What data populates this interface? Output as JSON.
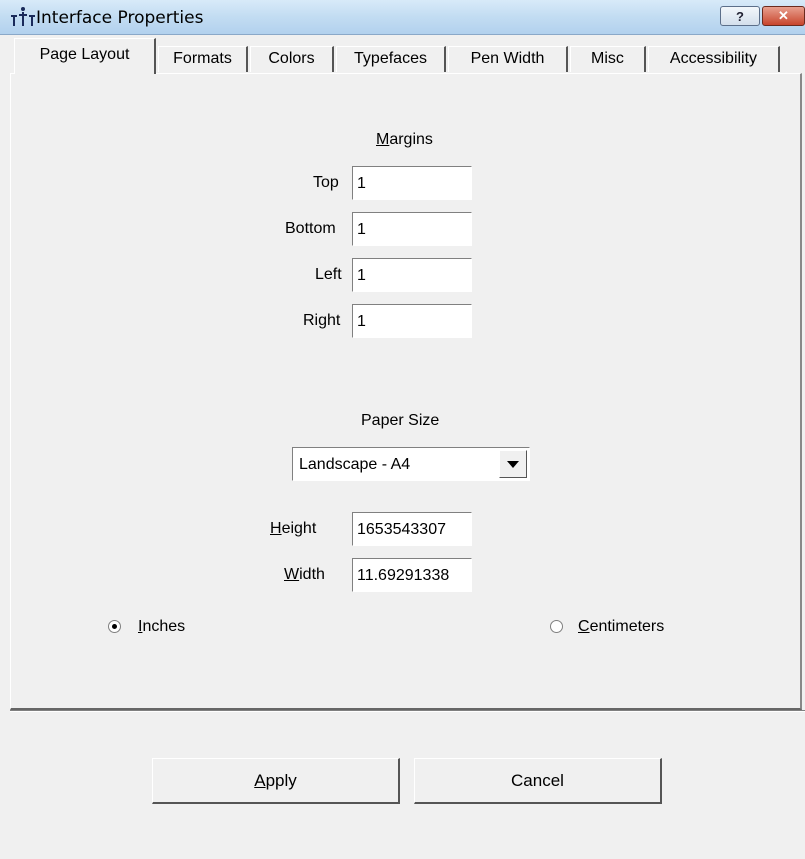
{
  "window": {
    "title": "Interface Properties",
    "help_glyph": "?",
    "close_glyph": "✕"
  },
  "tabs": [
    {
      "label": "Page Layout",
      "active": true
    },
    {
      "label": "Formats"
    },
    {
      "label": "Colors"
    },
    {
      "label": "Typefaces"
    },
    {
      "label": "Pen Width"
    },
    {
      "label": "Misc"
    },
    {
      "label": "Accessibility"
    }
  ],
  "margins": {
    "heading_mnemonic": "M",
    "heading_rest": "argins",
    "top_label": "Top",
    "top_value": "1",
    "bottom_label": "Bottom",
    "bottom_value": "1",
    "left_label": "Left",
    "left_value": "1",
    "right_label": "Right",
    "right_value": "1"
  },
  "paper": {
    "heading": "Paper Size",
    "selected": "Landscape - A4",
    "height_mnemonic": "H",
    "height_rest": "eight",
    "height_value": "16535433​07",
    "width_mnemonic": "W",
    "width_rest": "idth",
    "width_value": "11.69291338"
  },
  "units": {
    "inches_mnemonic": "I",
    "inches_rest": "nches",
    "inches_checked": true,
    "centimeters_mnemonic": "C",
    "centimeters_rest": "entimeters",
    "centimeters_checked": false
  },
  "buttons": {
    "apply_mnemonic": "A",
    "apply_rest": "pply",
    "cancel": "Cancel"
  },
  "icons": [
    "app-icon",
    "help-icon",
    "close-icon",
    "chevron-down-icon"
  ]
}
